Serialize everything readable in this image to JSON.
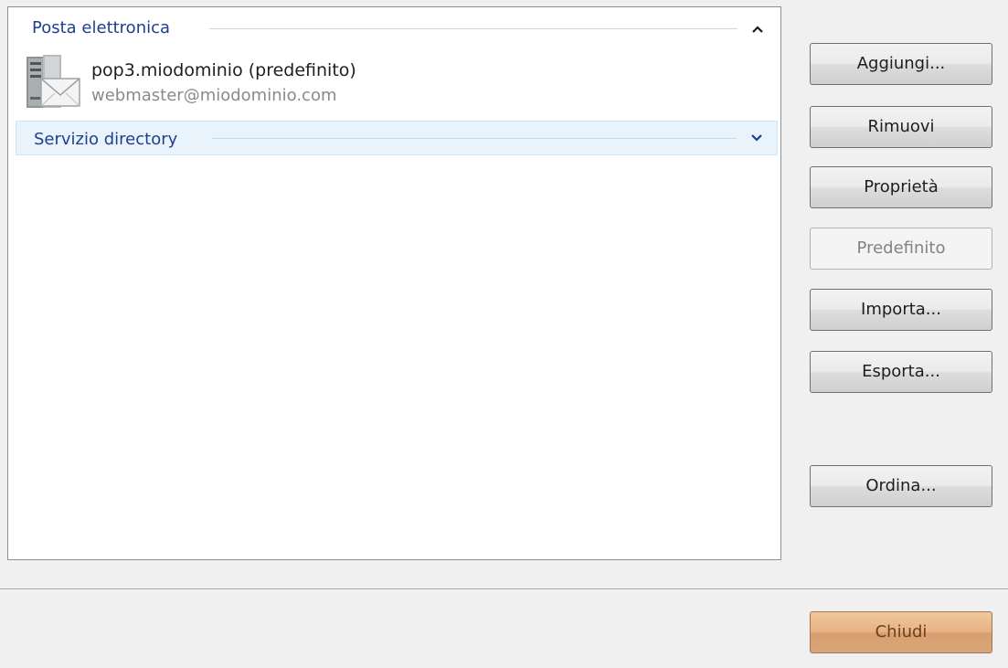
{
  "list": {
    "email_group": {
      "title": "Posta elettronica",
      "icon": "chevron-up-icon"
    },
    "accounts": [
      {
        "name": "pop3.miodominio (predefinito)",
        "address": "webmaster@miodominio.com",
        "icon": "mail-server-icon"
      }
    ],
    "directory_group": {
      "title": "Servizio directory",
      "icon": "chevron-down-icon"
    }
  },
  "buttons": {
    "add": "Aggiungi...",
    "remove": "Rimuovi",
    "properties": "Proprietà",
    "default": "Predefinito",
    "import": "Importa...",
    "export": "Esporta...",
    "sort": "Ordina..."
  },
  "footer": {
    "close": "Chiudi"
  },
  "colors": {
    "group_title": "#1f3e8f",
    "selected_group_bg": "#e9f3fb",
    "close_button": "#e7b386"
  }
}
